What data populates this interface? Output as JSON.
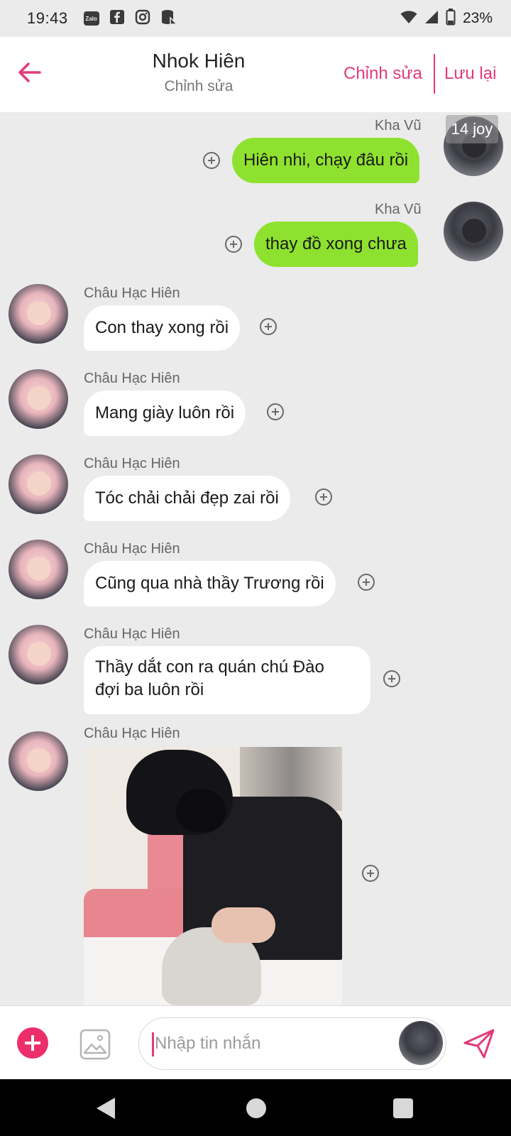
{
  "status_bar": {
    "time": "19:43",
    "app_icons": [
      "zalo-icon",
      "facebook-icon",
      "instagram-icon",
      "database-icon"
    ],
    "zalo_label": "Zalo",
    "battery": "23%"
  },
  "header": {
    "title": "Nhok Hiên",
    "subtitle": "Chỉnh sửa",
    "edit_label": "Chỉnh sửa",
    "save_label": "Lưu lại",
    "accent_color": "#e23a7a"
  },
  "messages": [
    {
      "sender": "Kha Vũ",
      "text": "Hiên nhi, chạy đâu rồi",
      "direction": "outgoing",
      "badge": "14 joy"
    },
    {
      "sender": "Kha Vũ",
      "text": "thay đồ xong chưa",
      "direction": "outgoing"
    },
    {
      "sender": "Châu Hạc Hiên",
      "text": "Con thay xong rồi",
      "direction": "incoming"
    },
    {
      "sender": "Châu Hạc Hiên",
      "text": "Mang giày luôn rồi",
      "direction": "incoming"
    },
    {
      "sender": "Châu Hạc Hiên",
      "text": "Tóc chải chải đẹp zai rồi",
      "direction": "incoming"
    },
    {
      "sender": "Châu Hạc Hiên",
      "text": "Cũng qua nhà thầy Trương rồi",
      "direction": "incoming"
    },
    {
      "sender": "Châu Hạc Hiên",
      "lines": [
        "Thầy dắt con ra quán chú Đào",
        "đợi ba luôn rồi"
      ],
      "direction": "incoming"
    },
    {
      "sender": "Châu Hạc Hiên",
      "type": "photo",
      "direction": "incoming"
    }
  ],
  "input": {
    "placeholder": "Nhập tin nhắn"
  },
  "colors": {
    "outgoing_bubble": "#8ee22f",
    "incoming_bubble": "#ffffff",
    "chat_background": "#ebebeb",
    "add_button": "#ec2f6c"
  }
}
